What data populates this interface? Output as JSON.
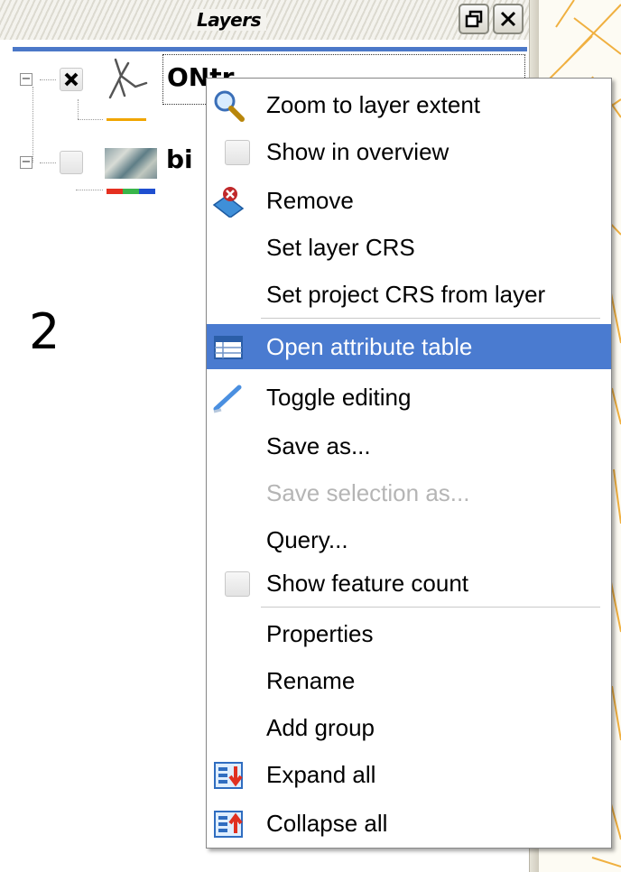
{
  "panel": {
    "title": "Layers",
    "restore_icon": "restore-window-icon",
    "close_icon": "close-icon"
  },
  "layers": [
    {
      "name": "ONtr",
      "visible": true,
      "icon": "line-layer-icon",
      "legend_color": "#f0a500"
    },
    {
      "name": "bi",
      "visible": false,
      "icon": "raster-layer-icon",
      "legend_colors": [
        "#e53020",
        "#39b54a",
        "#1f4fd0"
      ]
    }
  ],
  "annotation_number": "2",
  "context_menu": {
    "items": [
      {
        "label": "Zoom to layer extent",
        "icon": "zoom-extent-icon"
      },
      {
        "label": "Show in overview",
        "icon": "checkbox",
        "checked": false
      },
      {
        "label": "Remove",
        "icon": "remove-layer-icon"
      },
      {
        "label": "Set layer CRS"
      },
      {
        "label": "Set project CRS from layer"
      },
      {
        "label": "Open attribute table",
        "icon": "attribute-table-icon",
        "selected": true
      },
      {
        "label": "Toggle editing",
        "icon": "pencil-icon"
      },
      {
        "label": "Save as..."
      },
      {
        "label": "Save selection as...",
        "disabled": true
      },
      {
        "label": "Query..."
      },
      {
        "label": "Show feature count",
        "icon": "checkbox",
        "checked": false
      },
      {
        "label": "Properties"
      },
      {
        "label": "Rename"
      },
      {
        "label": "Add group"
      },
      {
        "label": "Expand all",
        "icon": "expand-all-icon"
      },
      {
        "label": "Collapse all",
        "icon": "collapse-all-icon"
      }
    ]
  },
  "colors": {
    "selection": "#4a7bd0",
    "title_rule": "#4b78c8",
    "map_lines": "#f0b040"
  }
}
